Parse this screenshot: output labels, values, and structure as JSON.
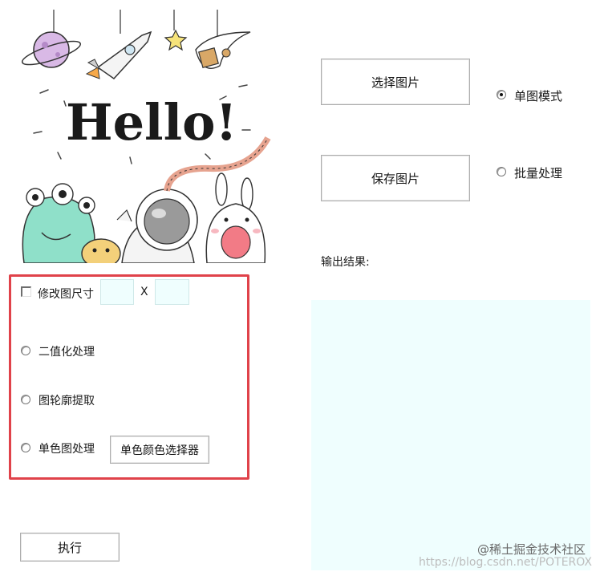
{
  "hero": {
    "title": "Hello!"
  },
  "buttons": {
    "select_image": "选择图片",
    "save_image": "保存图片",
    "mono_color_picker": "单色颜色选择器",
    "execute": "执行"
  },
  "mode": {
    "single": "单图模式",
    "batch": "批量处理",
    "selected": "single"
  },
  "options": {
    "resize_label": "修改图尺寸",
    "resize_x_label": "X",
    "width_value": "",
    "height_value": "",
    "binarize": "二值化处理",
    "contour": "图轮廓提取",
    "monochrome": "单色图处理"
  },
  "output": {
    "label": "输出结果:"
  },
  "watermark": {
    "brand": "@稀土掘金技术社区",
    "url": "https://blog.csdn.net/POTEROX"
  },
  "colors": {
    "highlight_border": "#e0424a",
    "input_bg": "#effefe"
  }
}
